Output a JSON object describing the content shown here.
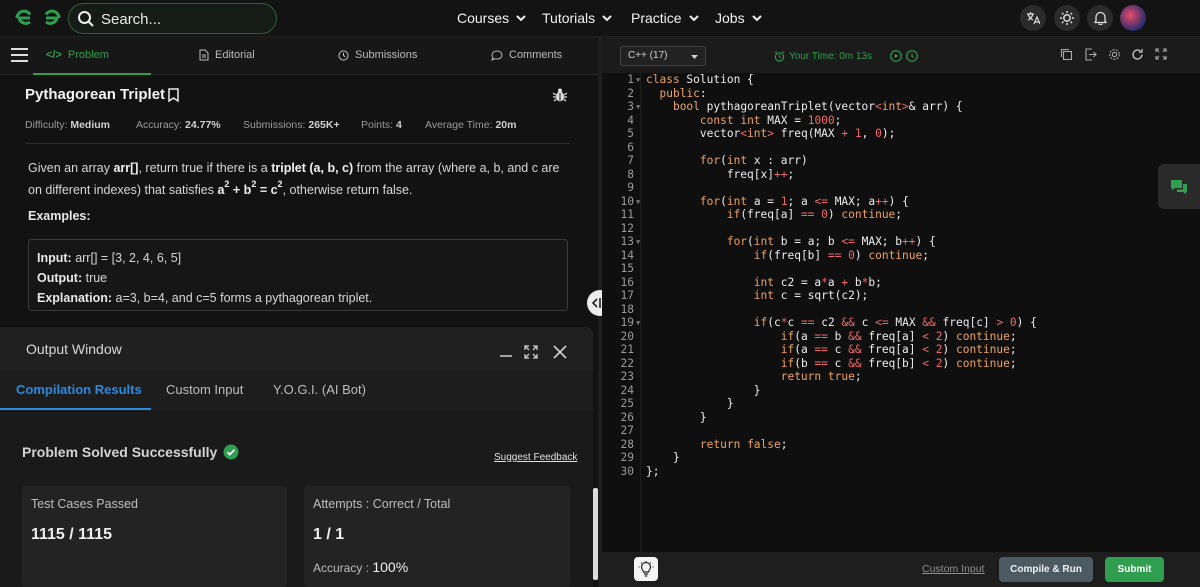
{
  "header": {
    "search_placeholder": "Search...",
    "nav": [
      "Courses",
      "Tutorials",
      "Practice",
      "Jobs"
    ]
  },
  "tabs": {
    "problem": "Problem",
    "editorial": "Editorial",
    "submissions": "Submissions",
    "comments": "Comments"
  },
  "problem": {
    "title": "Pythagorean Triplet",
    "difficulty_label": "Difficulty:",
    "difficulty": "Medium",
    "accuracy_label": "Accuracy:",
    "accuracy": "24.77%",
    "submissions_label": "Submissions:",
    "submissions": "265K+",
    "points_label": "Points:",
    "points": "4",
    "avg_time_label": "Average Time:",
    "avg_time": "20m",
    "desc_1": "Given an array ",
    "desc_arr": "arr[]",
    "desc_2": ", return true if there is a ",
    "desc_triplet": "triplet (a, b, c)",
    "desc_3": " from the array (where a, b, and c are on different indexes) that satisfies ",
    "desc_4": ", otherwise return false.",
    "examples_label": "Examples:",
    "ex_input_label": "Input:",
    "ex_input": " arr[] = [3, 2, 4, 6, 5]",
    "ex_output_label": "Output:",
    "ex_output": " true",
    "ex_expl_label": "Explanation:",
    "ex_expl": " a=3, b=4, and c=5 forms a pythagorean triplet."
  },
  "output": {
    "title": "Output Window",
    "tabs": [
      "Compilation Results",
      "Custom Input",
      "Y.O.G.I. (AI Bot)"
    ],
    "status": "Problem Solved Successfully",
    "feedback": "Suggest Feedback",
    "tests_label": "Test Cases Passed",
    "tests_value": "1115 / 1115",
    "attempts_label": "Attempts : Correct / Total",
    "attempts_value": "1 / 1",
    "accuracy_label": "Accuracy : ",
    "accuracy_value": "100%"
  },
  "editor": {
    "language": "C++ (17)",
    "timer": "Your Time: 0m 13s",
    "custom_input": "Custom Input",
    "compile_run": "Compile & Run",
    "submit": "Submit"
  },
  "colors": {
    "brand_green": "#2f9e4e",
    "accent_blue": "#2a8ae0",
    "keyword_orange": "#f0a35e",
    "number_red": "#ef6b6b"
  }
}
